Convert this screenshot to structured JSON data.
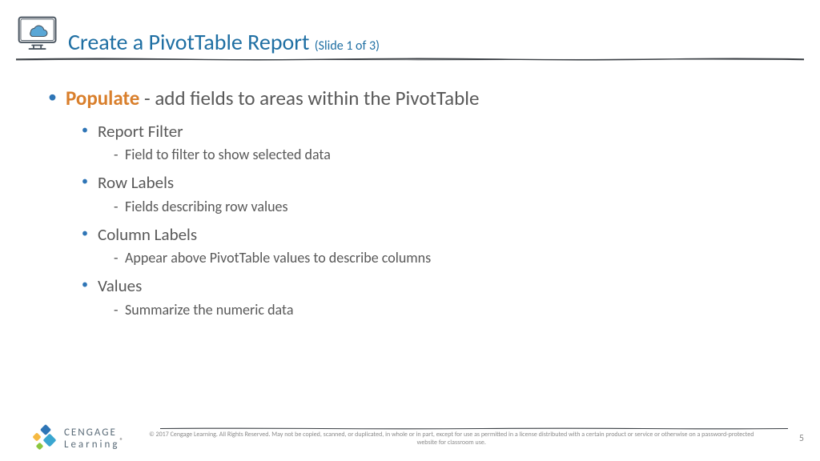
{
  "header": {
    "title_main": "Create a PivotTable Report ",
    "title_sub": "(Slide 1 of 3)"
  },
  "content": {
    "strong": "Populate",
    "lead": " - add fields to areas within the PivotTable",
    "items": [
      {
        "label": "Report Filter",
        "desc": "Field to filter to show selected data"
      },
      {
        "label": "Row Labels",
        "desc": "Fields describing row values"
      },
      {
        "label": "Column Labels",
        "desc": "Appear above PivotTable values to describe columns"
      },
      {
        "label": "Values",
        "desc": "Summarize the numeric data"
      }
    ]
  },
  "footer": {
    "logo_l1": "CENGAGE",
    "logo_l2": "Learning",
    "copyright": "© 2017 Cengage Learning. All Rights Reserved. May not be copied, scanned, or duplicated, in whole or in part, except for use as permitted in a license distributed with a certain product or service or otherwise on a password-protected website for classroom use.",
    "page": "5"
  }
}
